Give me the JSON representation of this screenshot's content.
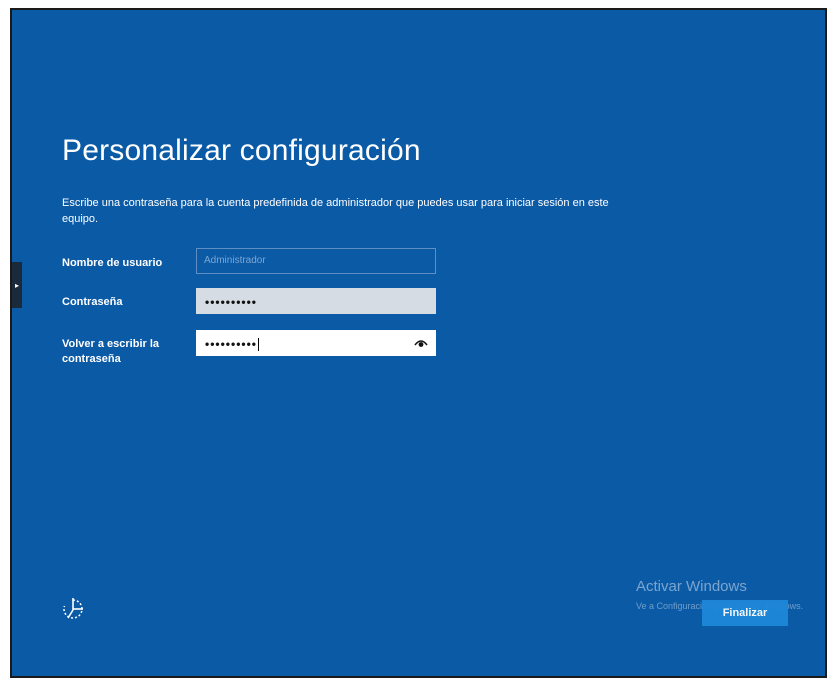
{
  "setup": {
    "title": "Personalizar configuración",
    "description": "Escribe una contraseña para la cuenta predefinida de administrador que puedes usar para iniciar sesión en este equipo.",
    "fields": {
      "username_label": "Nombre de usuario",
      "username_placeholder": "Administrador",
      "password_label": "Contraseña",
      "password_value": "••••••••••",
      "confirm_label": "Volver a escribir la contraseña",
      "confirm_value": "••••••••••"
    },
    "finish_label": "Finalizar"
  },
  "watermark": {
    "title": "Activar Windows",
    "subtitle": "Ve a Configuración para activar Windows."
  },
  "icons": {
    "reveal": "eye-icon",
    "accessibility": "ease-of-access-icon",
    "side_tab": "chevron-right-icon"
  },
  "colors": {
    "background": "#0b5aa6",
    "button": "#1e88d8"
  }
}
